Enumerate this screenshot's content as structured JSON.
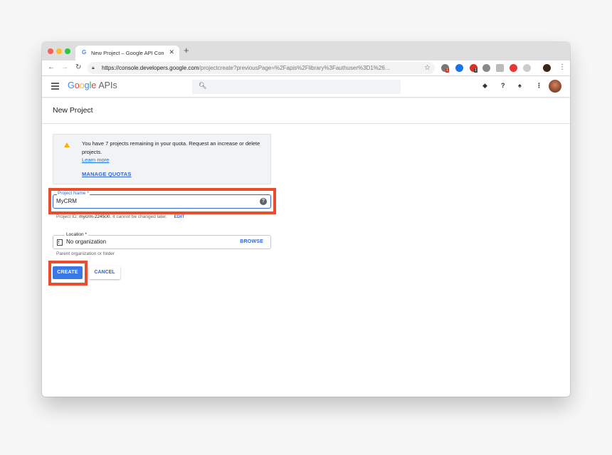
{
  "browser": {
    "tab_title": "New Project – Google API Con",
    "tab_favicon": "G",
    "new_tab_glyph": "+",
    "url_host": "https://console.developers.google.com",
    "url_path": "/projectcreate?previousPage=%2Fapis%2Flibrary%3Fauthuser%3D1%26...",
    "extension_badges": [
      "1",
      "1"
    ]
  },
  "header": {
    "logo_parts": [
      "G",
      "o",
      "o",
      "g",
      "l",
      "e"
    ],
    "logo_suffix": "APIs",
    "search_placeholder": ""
  },
  "page": {
    "title": "New Project"
  },
  "notice": {
    "message": "You have 7 projects remaining in your quota. Request an increase or delete projects.",
    "learn_more": "Learn more",
    "manage_quotas": "MANAGE QUOTAS"
  },
  "form": {
    "project_name_label": "Project Name",
    "project_name_required": "*",
    "project_name_value": "MyCRM",
    "project_id_text": "Project ID: ",
    "project_id_value": "mycrm-224500",
    "project_id_note": ". It cannot be changed later.",
    "edit_label": "EDIT",
    "location_label": "Location *",
    "location_value": "No organization",
    "browse_label": "BROWSE",
    "location_hint": "Parent organization or folder",
    "create_label": "CREATE",
    "cancel_label": "CANCEL"
  },
  "colors": {
    "highlight": "#e84e2e",
    "primary": "#3b78e7",
    "link": "#3367d6"
  }
}
